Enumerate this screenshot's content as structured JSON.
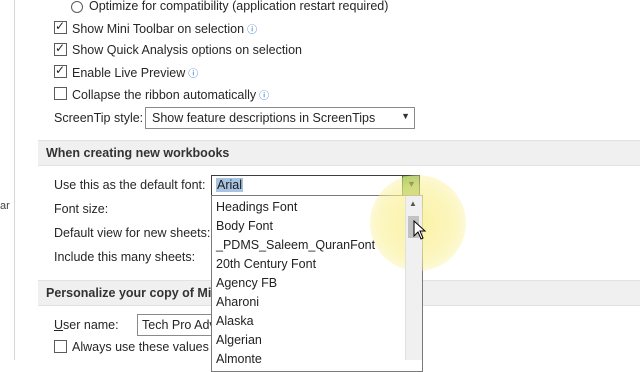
{
  "general": {
    "optimize_compat": "Optimize for compatibility (application restart required)",
    "mini_toolbar": "Show Mini Toolbar on selection",
    "quick_analysis": "Show Quick Analysis options on selection",
    "live_preview": "Enable Live Preview",
    "collapse_ribbon": "Collapse the ribbon automatically",
    "screentip_label": "ScreenTip style:",
    "screentip_value": "Show feature descriptions in ScreenTips"
  },
  "new_workbooks": {
    "section_title": "When creating new workbooks",
    "default_font_label": "Use this as the default font:",
    "default_font_value": "Arial",
    "font_size_label": "Font size:",
    "default_view_label": "Default view for new sheets:",
    "sheets_label": "Include this many sheets:"
  },
  "font_list": [
    "Headings Font",
    "Body Font",
    "_PDMS_Saleem_QuranFont",
    "20th Century Font",
    "Agency FB",
    "Aharoni",
    "Alaska",
    "Algerian",
    "Almonte"
  ],
  "personalize": {
    "section_title": "Personalize your copy of Micr",
    "user_name_label": "User name:",
    "user_name_value": "Tech Pro Adv",
    "always_use": "Always use these values re"
  },
  "left_nav": {
    "partial_text": "ar"
  },
  "icons": {
    "info": "info-icon",
    "dropdown": "chevron-down-icon",
    "scroll_up": "scroll-up-icon",
    "cursor": "mouse-pointer-icon"
  },
  "colors": {
    "selected_text_bg": "#a9c4e3",
    "dropdown_button": "#8fbc5c",
    "section_bg": "#f0f0f0",
    "info_icon": "#2b6fc2",
    "cursor_highlight": "#faf096"
  }
}
